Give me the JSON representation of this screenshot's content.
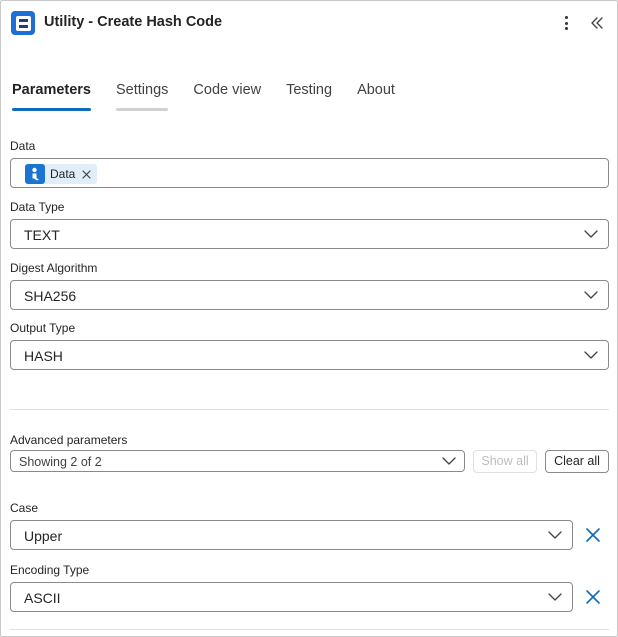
{
  "header": {
    "title": "Utility - Create Hash Code",
    "logo_icon": "app-logo-icon",
    "more_icon": "more-vertical-icon",
    "collapse_icon": "double-chevron-left-icon"
  },
  "tabs": [
    {
      "label": "Parameters",
      "active": true
    },
    {
      "label": "Settings",
      "active": false
    },
    {
      "label": "Code view",
      "active": false
    },
    {
      "label": "Testing",
      "active": false
    },
    {
      "label": "About",
      "active": false
    }
  ],
  "fields": {
    "data": {
      "label": "Data",
      "token_label": "Data",
      "token_icon": "user-icon"
    },
    "data_type": {
      "label": "Data Type",
      "value": "TEXT"
    },
    "digest_algorithm": {
      "label": "Digest Algorithm",
      "value": "SHA256"
    },
    "output_type": {
      "label": "Output Type",
      "value": "HASH"
    }
  },
  "advanced": {
    "label": "Advanced parameters",
    "selected": "Showing 2 of 2",
    "show_all_label": "Show all",
    "clear_all_label": "Clear all"
  },
  "advanced_fields": {
    "case": {
      "label": "Case",
      "value": "Upper"
    },
    "encoding_type": {
      "label": "Encoding Type",
      "value": "ASCII"
    }
  },
  "colors": {
    "accent": "#0f6cbd",
    "token_bg": "#e1eefa",
    "remove_x": "#0f6cbd"
  }
}
